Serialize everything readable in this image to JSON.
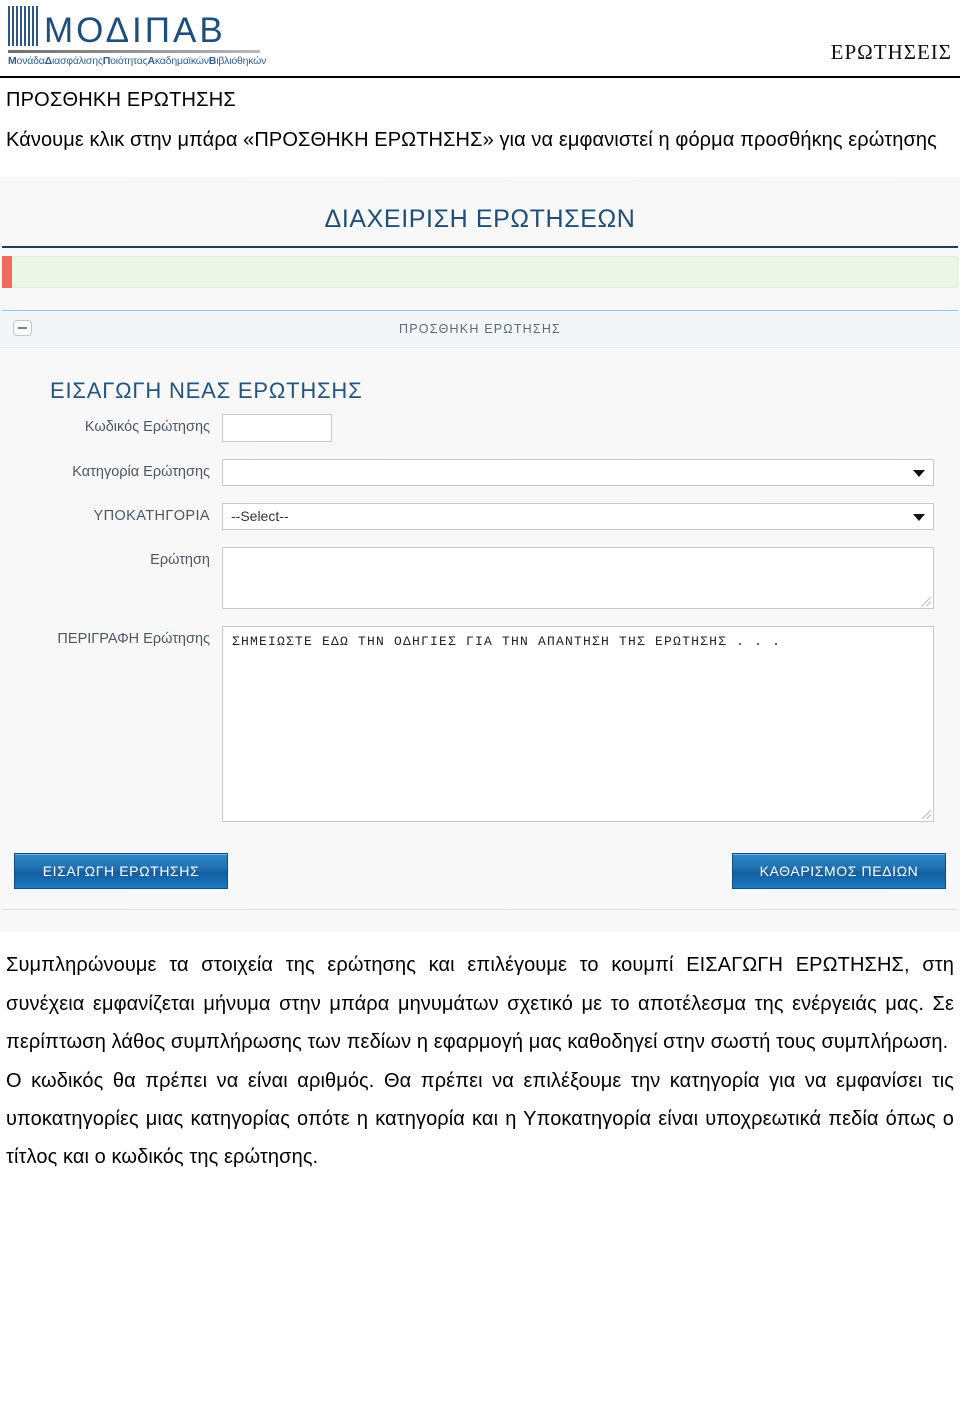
{
  "header": {
    "logo_word": "ΜΟΔΙΠΑΒ",
    "logo_subtitle_parts": [
      {
        "bold": "Μ",
        "rest": "ονάδα"
      },
      {
        "bold": "Δ",
        "rest": "ιασφάλισης"
      },
      {
        "bold": "Π",
        "rest": "οιότητας"
      },
      {
        "bold": "Α",
        "rest": "καδημαϊκών"
      },
      {
        "bold": "Β",
        "rest": "ιβλιοθηκών"
      }
    ],
    "right_label": "ΕΡΩΤΗΣΕΙΣ"
  },
  "intro": {
    "section_title": "ΠΡΟΣΘΗΚΗ ΕΡΩΤΗΣΗΣ",
    "paragraph": "Κάνουμε κλικ στην μπάρα «ΠΡΟΣΘΗΚΗ ΕΡΩΤΗΣΗΣ» για να εμφανιστεί η φόρμα προσθήκης ερώτησης"
  },
  "screenshot": {
    "app_title": "ΔΙΑΧΕΙΡΙΣΗ ΕΡΩΤΗΣΕΩΝ",
    "message_bar": {
      "text": "",
      "background_color": "#eaf6e6",
      "marker_color": "#ef6b5d"
    },
    "panel": {
      "header_label": "ΠΡΟΣΘΗΚΗ ΕΡΩΤΗΣΗΣ",
      "collapse_icon": "minus-icon"
    },
    "form": {
      "title": "ΕΙΣΑΓΩΓΗ ΝΕΑΣ ΕΡΩΤΗΣΗΣ",
      "fields": [
        {
          "label": "Κωδικός Ερώτησης",
          "type": "text",
          "value": "",
          "name": "question-code-input"
        },
        {
          "label": "Κατηγορία Ερώτησης",
          "type": "select",
          "value": "",
          "name": "question-category-select"
        },
        {
          "label": "ΥΠΟΚΑΤΗΓΟΡΙΑ",
          "type": "select",
          "value": "--Select--",
          "name": "question-subcategory-select"
        },
        {
          "label": "Ερώτηση",
          "type": "textarea-small",
          "value": "",
          "name": "question-text-area"
        },
        {
          "label": "ΠΕΡΙΓΡΑΦΗ Ερώτησης",
          "type": "textarea-large",
          "value": "ΣΗΜΕΙΩΣΤΕ ΕΔΩ ΤΗΝ ΟΔΗΓΙΕΣ ΓΙΑ ΤΗΝ ΑΠΑΝΤΗΣΗ ΤΗΣ ΕΡΩΤΗΣΗΣ . . .",
          "name": "question-description-area"
        }
      ],
      "submit_button": "ΕΙΣΑΓΩΓΗ ΕΡΩΤΗΣΗΣ",
      "clear_button": "ΚΑΘΑΡΙΣΜΟΣ ΠΕΔΙΩΝ",
      "button_color": "#1f6fb0"
    },
    "title_color": "#1f4e79"
  },
  "outro": {
    "paragraph_1": "Συμπληρώνουμε τα στοιχεία της ερώτησης και επιλέγουμε το κουμπί ΕΙΣΑΓΩΓΗ ΕΡΩΤΗΣΗΣ, στη συνέχεια εμφανίζεται μήνυμα στην μπάρα μηνυμάτων σχετικό με το αποτέλεσμα της ενέργειάς μας. Σε περίπτωση λάθος συμπλήρωσης των πεδίων η εφαρμογή μας καθοδηγεί στην σωστή τους συμπλήρωση.",
    "paragraph_2": "Ο κωδικός θα πρέπει να είναι αριθμός. Θα πρέπει να επιλέξουμε την κατηγορία για να εμφανίσει τις υποκατηγορίες μιας κατηγορίας οπότε η κατηγορία και η Υποκατηγορία είναι υποχρεωτικά πεδία όπως ο τίτλος και ο κωδικός της ερώτησης."
  }
}
